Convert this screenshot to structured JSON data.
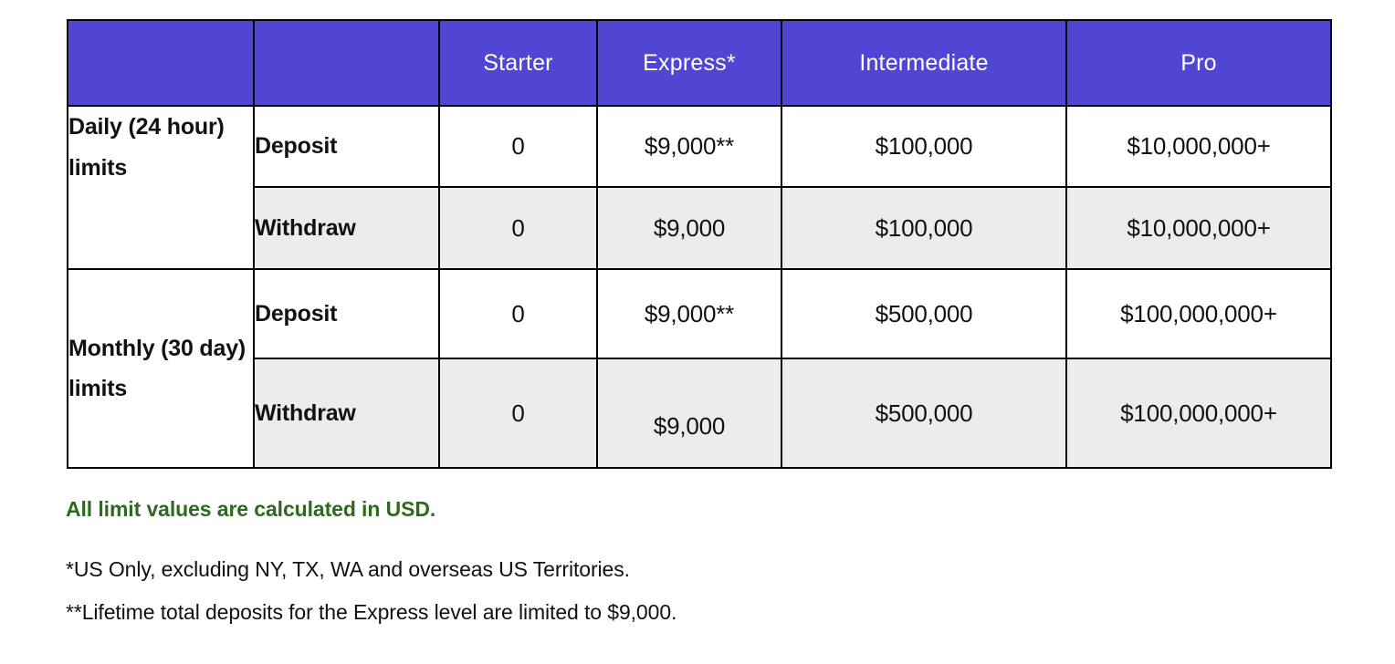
{
  "table": {
    "headers": [
      "",
      "",
      "Starter",
      "Express*",
      "Intermediate",
      "Pro"
    ],
    "groups": [
      {
        "label": "Daily (24 hour) limits",
        "rows": [
          {
            "action": "Deposit",
            "values": [
              "0",
              "$9,000**",
              "$100,000",
              "$10,000,000+"
            ]
          },
          {
            "action": "Withdraw",
            "values": [
              "0",
              "$9,000",
              "$100,000",
              "$10,000,000+"
            ]
          }
        ]
      },
      {
        "label": "Monthly (30 day) limits",
        "rows": [
          {
            "action": "Deposit",
            "values": [
              "0",
              "$9,000**",
              "$500,000",
              "$100,000,000+"
            ]
          },
          {
            "action": "Withdraw",
            "values": [
              "0",
              "$9,000",
              "$500,000",
              "$100,000,000+"
            ]
          }
        ]
      }
    ]
  },
  "notes": {
    "usd": "All limit values are calculated in USD.",
    "asterisk_one": "*US Only, excluding NY, TX, WA and overseas US Territories.",
    "asterisk_two": "**Lifetime total deposits for the Express level are limited to $9,000."
  },
  "colors": {
    "header_purple": "#5046d3",
    "row_alt_gray": "#ececec",
    "note_green": "#2d6a1f",
    "border": "#000000"
  }
}
